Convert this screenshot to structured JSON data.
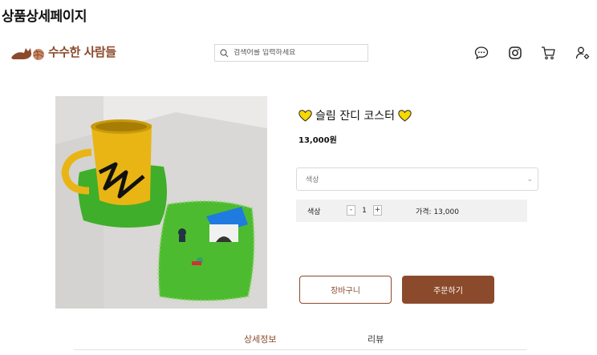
{
  "page": {
    "heading": "상품상세페이지"
  },
  "header": {
    "logo_text": "수수한 사람들",
    "search_placeholder": "검색어를 입력하세요",
    "icons": [
      "chat-icon",
      "instagram-icon",
      "cart-icon",
      "user-settings-icon"
    ]
  },
  "product": {
    "title": "슬림 잔디 코스터",
    "price": "13,000원",
    "color_select": {
      "placeholder": "색상"
    },
    "option": {
      "name": "색상",
      "minus": "-",
      "quantity": "1",
      "plus": "+",
      "price_label": "가격: 13,000"
    },
    "buttons": {
      "cart": "장바구니",
      "order": "주문하기"
    }
  },
  "tabs": {
    "detail": "상세정보",
    "review": "리뷰"
  },
  "colors": {
    "brand": "#8b4a2b",
    "heart": "#f7d800"
  }
}
